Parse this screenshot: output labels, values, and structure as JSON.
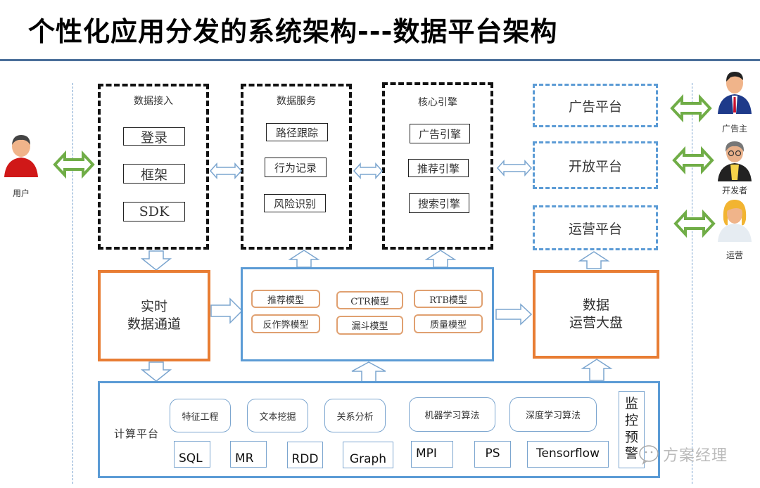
{
  "title": "个性化应用分发的系统架构---数据平台架构",
  "actors": {
    "user": "用户",
    "advertiser": "广告主",
    "developer": "开发者",
    "operator": "运营"
  },
  "data_access": {
    "title": "数据接入",
    "items": [
      "登录",
      "框架",
      "SDK"
    ]
  },
  "data_service": {
    "title": "数据服务",
    "items": [
      "路径跟踪",
      "行为记录",
      "风险识别"
    ]
  },
  "core_engine": {
    "title": "核心引擎",
    "items": [
      "广告引擎",
      "推荐引擎",
      "搜索引擎"
    ]
  },
  "platforms": [
    "广告平台",
    "开放平台",
    "运营平台"
  ],
  "realtime_channel": {
    "line1": "实时",
    "line2": "数据通道"
  },
  "models": [
    "推荐模型",
    "CTR模型",
    "RTB模型",
    "反作弊模型",
    "漏斗模型",
    "质量模型"
  ],
  "data_dashboard": {
    "line1": "数据",
    "line2": "运营大盘"
  },
  "compute_platform": {
    "label": "计算平台",
    "algorithms": [
      "特征工程",
      "文本挖掘",
      "关系分析",
      "机器学习算法",
      "深度学习算法"
    ],
    "engines": [
      "SQL",
      "MR",
      "RDD",
      "Graph",
      "MPI",
      "PS",
      "Tensorflow"
    ],
    "monitor": [
      "监",
      "控",
      "预",
      "警"
    ]
  },
  "watermark": "方案经理",
  "colors": {
    "accent_blue": "#5b9bd5",
    "accent_orange": "#e87d34",
    "arrow_green": "#70ad47",
    "rule": "#4a6f9a"
  }
}
